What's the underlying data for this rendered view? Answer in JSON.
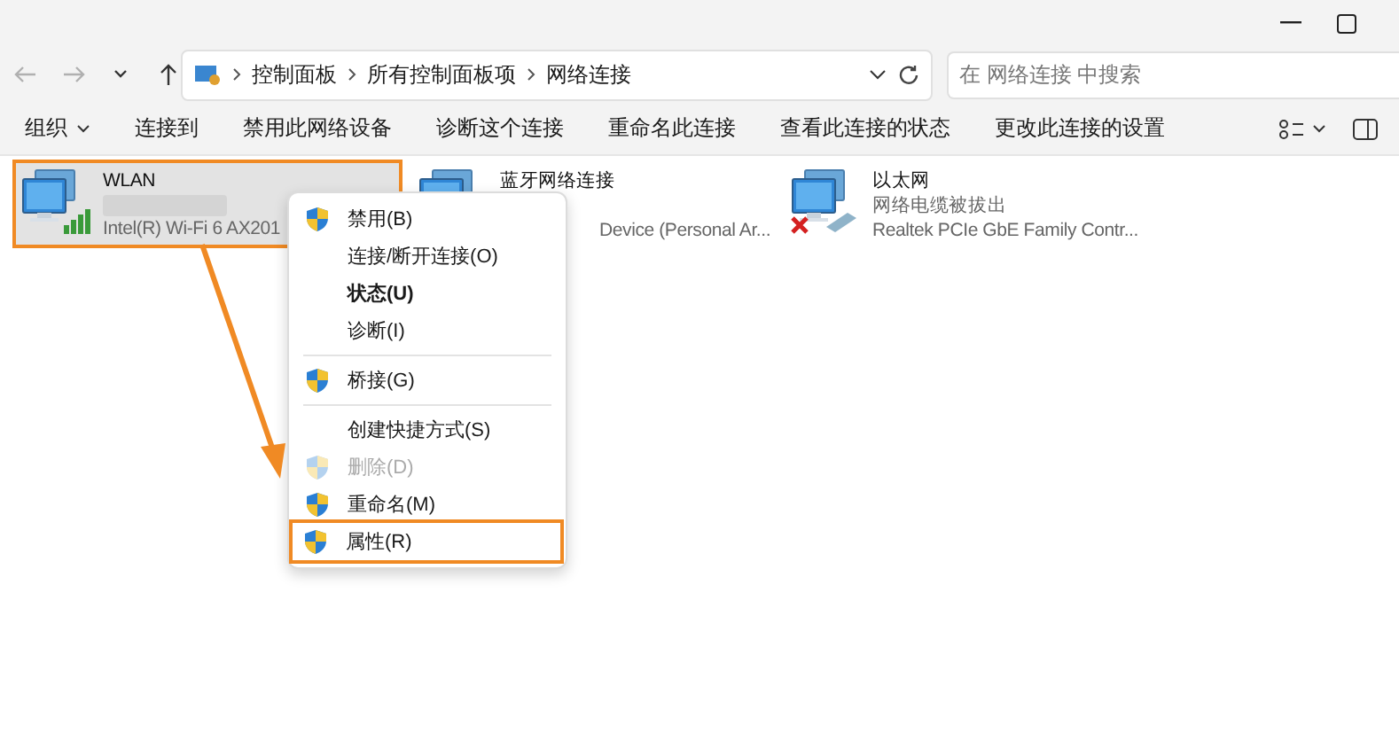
{
  "nav_buttons": [
    {
      "kind": "back",
      "disabled": true
    },
    {
      "kind": "forward",
      "disabled": true
    },
    {
      "kind": "recent",
      "disabled": false
    },
    {
      "kind": "up",
      "disabled": false
    }
  ],
  "address": {
    "crumbs": [
      "控制面板",
      "所有控制面板项",
      "网络连接"
    ]
  },
  "search": {
    "placeholder": "在 网络连接 中搜索"
  },
  "toolbar": {
    "items": [
      {
        "label": "组织",
        "dropdown": true
      },
      {
        "label": "连接到",
        "dropdown": false
      },
      {
        "label": "禁用此网络设备",
        "dropdown": false
      },
      {
        "label": "诊断这个连接",
        "dropdown": false
      },
      {
        "label": "重命名此连接",
        "dropdown": false
      },
      {
        "label": "查看此连接的状态",
        "dropdown": false
      },
      {
        "label": "更改此连接的设置",
        "dropdown": false
      }
    ]
  },
  "connections": [
    {
      "kind": "wifi",
      "name": "WLAN",
      "status_blurred": true,
      "device": "Intel(R) Wi-Fi 6 AX201",
      "selected": true,
      "highlighted": true
    },
    {
      "kind": "bluetooth",
      "name": "蓝牙网络连接",
      "device": "Device (Personal Ar...",
      "selected": false,
      "highlighted": false
    },
    {
      "kind": "ethernet",
      "name": "以太网",
      "status": "网络电缆被拔出",
      "device": "Realtek PCIe GbE Family Contr...",
      "selected": false,
      "highlighted": false,
      "disconnected": true
    }
  ],
  "context_menu": {
    "items": [
      {
        "kind": "item",
        "label": "禁用(B)",
        "shield": true,
        "bold": false,
        "disabled": false,
        "highlighted": false
      },
      {
        "kind": "item",
        "label": "连接/断开连接(O)",
        "shield": false,
        "bold": false,
        "disabled": false,
        "highlighted": false
      },
      {
        "kind": "item",
        "label": "状态(U)",
        "shield": false,
        "bold": true,
        "disabled": false,
        "highlighted": false
      },
      {
        "kind": "item",
        "label": "诊断(I)",
        "shield": false,
        "bold": false,
        "disabled": false,
        "highlighted": false
      },
      {
        "kind": "separator"
      },
      {
        "kind": "item",
        "label": "桥接(G)",
        "shield": true,
        "bold": false,
        "disabled": false,
        "highlighted": false
      },
      {
        "kind": "separator"
      },
      {
        "kind": "item",
        "label": "创建快捷方式(S)",
        "shield": false,
        "bold": false,
        "disabled": false,
        "highlighted": false
      },
      {
        "kind": "item",
        "label": "删除(D)",
        "shield": true,
        "bold": false,
        "disabled": true,
        "highlighted": false
      },
      {
        "kind": "item",
        "label": "重命名(M)",
        "shield": true,
        "bold": false,
        "disabled": false,
        "highlighted": false
      },
      {
        "kind": "item",
        "label": "属性(R)",
        "shield": true,
        "bold": false,
        "disabled": false,
        "highlighted": true
      }
    ]
  }
}
